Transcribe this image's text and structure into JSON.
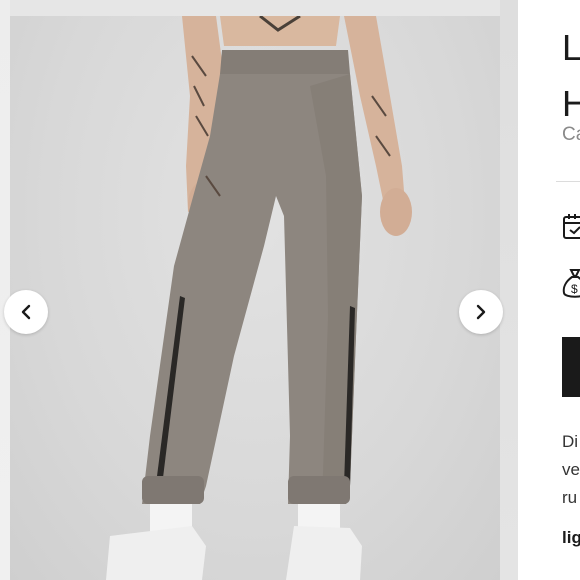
{
  "gallery": {
    "image_alt": "Grey-taupe high-rise jogger pants with black side stripes and elastic cuffs, worn with white sneakers",
    "prev_icon": "chevron-left-icon",
    "next_icon": "chevron-right-icon"
  },
  "product": {
    "title_partial": "L\nH",
    "subtitle_partial": "Ca",
    "delivery_icon": "calendar-check-icon",
    "payment_icon": "money-bag-icon",
    "description_partial": "Di\nve\nru",
    "feature_partial": "lig"
  },
  "colors": {
    "pants": "#8b847d",
    "background": "#dcdcdc",
    "button": "#1a1a1a"
  }
}
